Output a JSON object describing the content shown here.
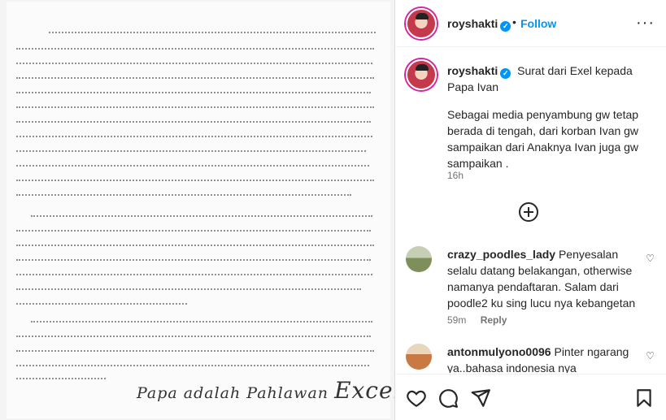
{
  "post": {
    "username": "royshakti",
    "follow_label": "Follow",
    "more_label": "···",
    "caption_title": "Surat dari Exel kepada Papa Ivan",
    "caption_body": "Sebagai media penyambung gw tetap berada di tengah, dari korban Ivan gw sampaikan dari Anaknya Ivan juga gw sampaikan .",
    "caption_time": "16h",
    "image": {
      "signature_prefix": "Papa adalah Pahlawan",
      "signature_name": "Excel"
    }
  },
  "comments": [
    {
      "username": "crazy_poodles_lady",
      "text": "Penyesalan selalu datang belakangan, otherwise namanya pendaftaran. Salam dari poodle2 ku sing lucu nya kebangetan",
      "time": "59m",
      "reply_label": "Reply"
    },
    {
      "username": "antonmulyono0096",
      "text": "Pinter ngarang ya..bahasa indonesia nya berapa...masih"
    }
  ],
  "icons": {
    "verified": "verified-badge-icon",
    "heart": "heart-icon",
    "comment": "comment-icon",
    "share": "share-icon",
    "save": "bookmark-icon",
    "load_more": "plus-circle-icon"
  },
  "colors": {
    "accent": "#0095f6",
    "text": "#262626",
    "muted": "#737373"
  }
}
